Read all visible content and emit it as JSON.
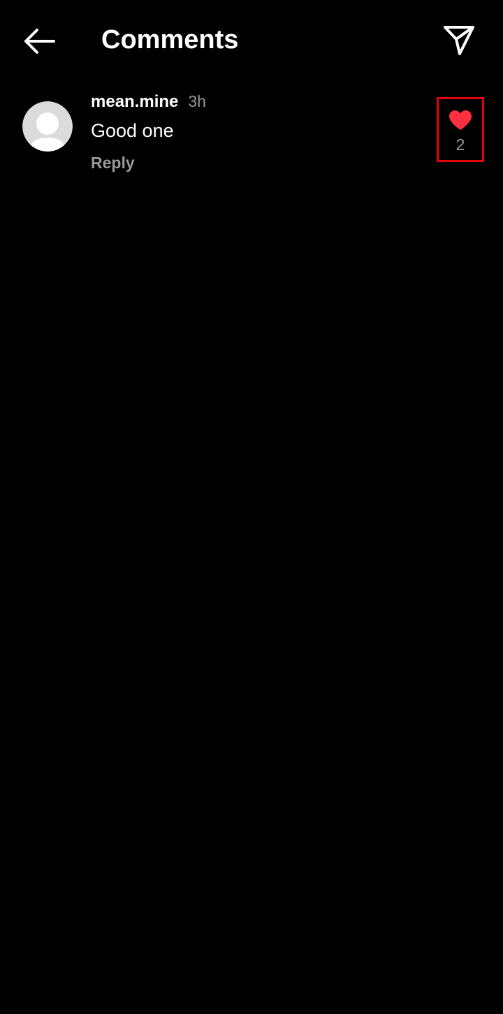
{
  "header": {
    "title": "Comments",
    "back_icon": "arrow-left-icon",
    "share_icon": "paper-plane-icon"
  },
  "comments": [
    {
      "username": "mean.mine",
      "time": "3h",
      "text": "Good one",
      "reply_label": "Reply",
      "like_count": "2",
      "liked": true,
      "avatar_icon": "default-avatar-icon"
    }
  ],
  "colors": {
    "background": "#000000",
    "text_primary": "#ffffff",
    "text_secondary": "#9a9a9a",
    "heart": "#ff3040",
    "highlight_box": "#e6000b",
    "avatar_bg": "#dbdbdb"
  }
}
